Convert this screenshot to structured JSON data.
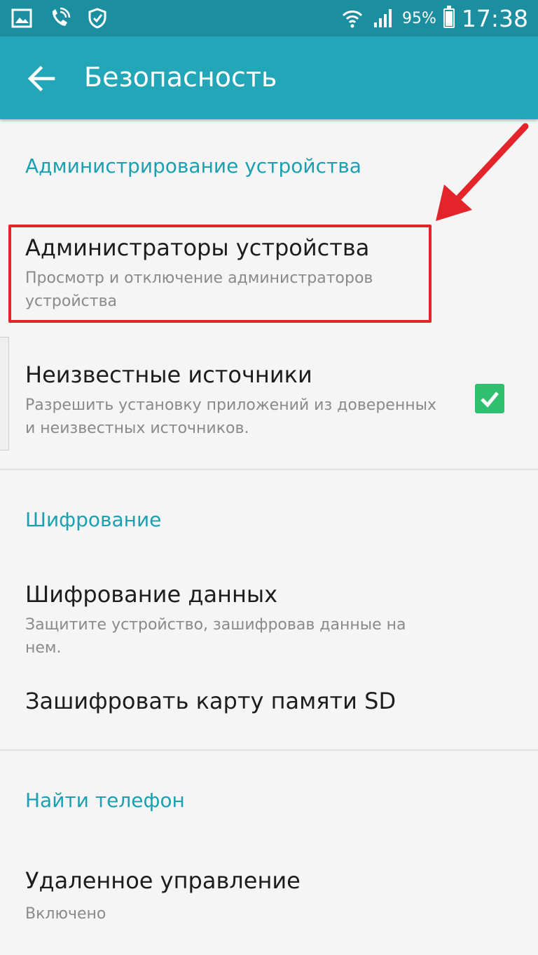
{
  "status_bar": {
    "battery_percent": "95%",
    "battery_level": 0.95,
    "time": "17:38",
    "icons": [
      "gallery-icon",
      "wifi-calling-icon",
      "shield-check-icon",
      "wifi-icon",
      "signal-icon",
      "battery-icon"
    ]
  },
  "app_bar": {
    "title": "Безопасность",
    "back_icon": "arrow-left-icon"
  },
  "sections": [
    {
      "header": "Администрирование устройства",
      "items": [
        {
          "title": "Администраторы устройства",
          "summary": "Просмотр и отключение администраторов устройства"
        },
        {
          "title": "Неизвестные источники",
          "summary": "Разрешить установку приложений из доверенных и неизвестных источников.",
          "checked": true
        }
      ]
    },
    {
      "header": "Шифрование",
      "items": [
        {
          "title": "Шифрование данных",
          "summary": "Защитите устройство, зашифровав данные на нем."
        },
        {
          "title": "Зашифровать карту памяти SD"
        }
      ]
    },
    {
      "header": "Найти телефон",
      "items": [
        {
          "title": "Удаленное управление",
          "summary": "Включено"
        }
      ]
    }
  ],
  "colors": {
    "status_bar": "#1b8ea0",
    "app_bar": "#22a6b8",
    "accent": "#1c9fb0",
    "checkbox": "#2fbf6f",
    "highlight": "#e4242b"
  },
  "annotation_icon": "red-arrow-icon"
}
